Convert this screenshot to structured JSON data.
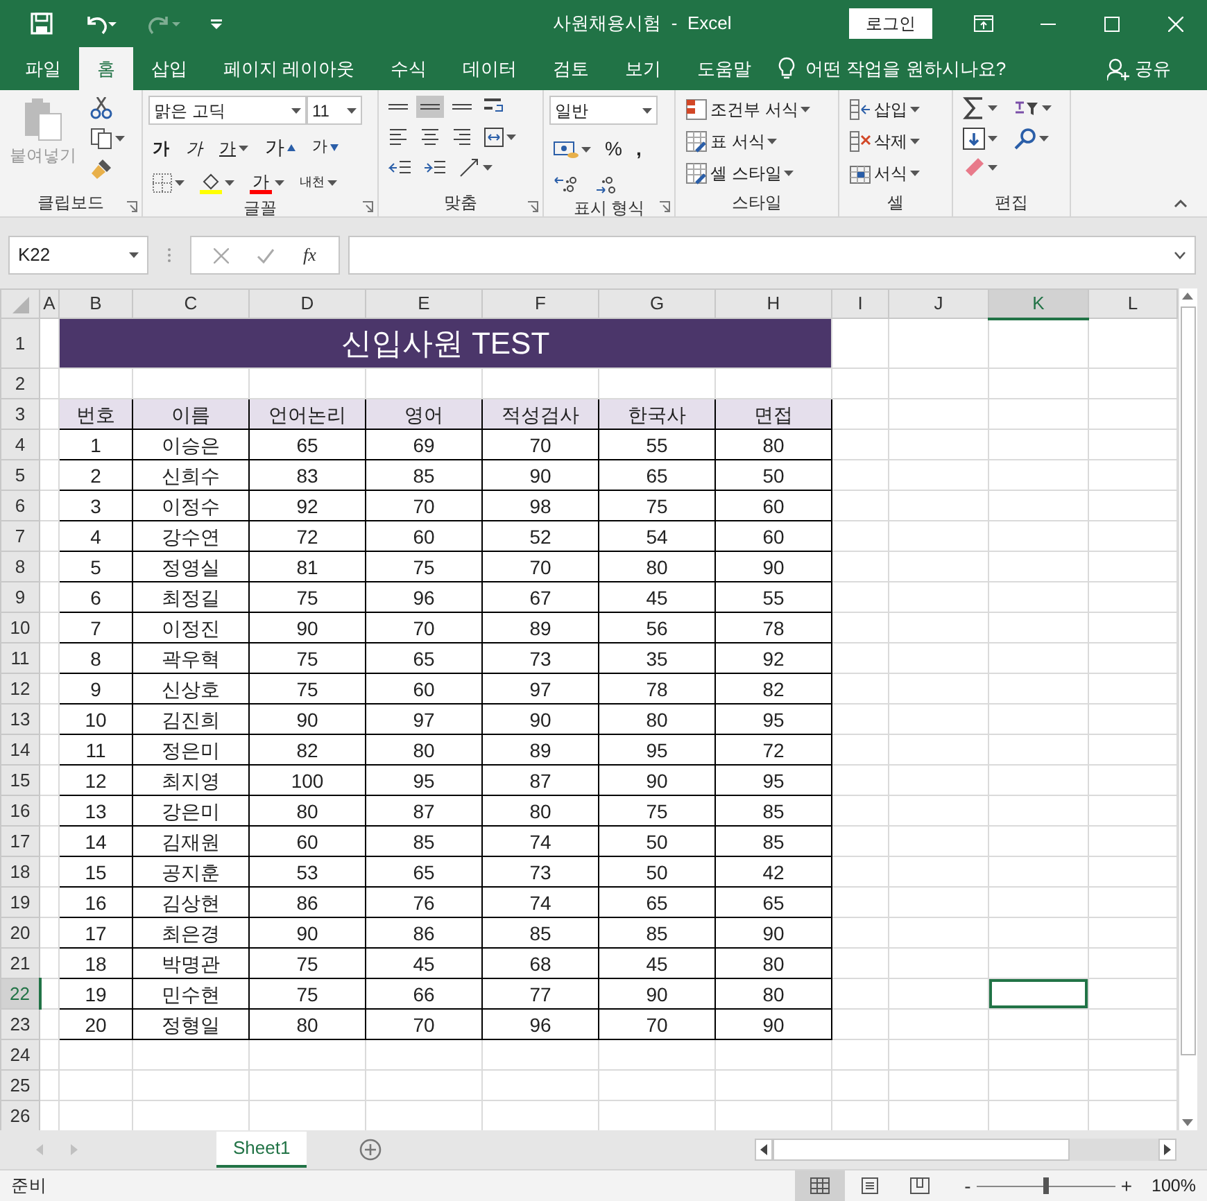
{
  "window": {
    "title": "사원채용시험  -  Excel",
    "login": "로그인"
  },
  "tabs": [
    {
      "label": "파일",
      "selected": false
    },
    {
      "label": "홈",
      "selected": true
    },
    {
      "label": "삽입",
      "selected": false
    },
    {
      "label": "페이지 레이아웃",
      "selected": false
    },
    {
      "label": "수식",
      "selected": false
    },
    {
      "label": "데이터",
      "selected": false
    },
    {
      "label": "검토",
      "selected": false
    },
    {
      "label": "보기",
      "selected": false
    },
    {
      "label": "도움말",
      "selected": false
    }
  ],
  "tell_me": {
    "placeholder": "어떤 작업을 원하시나요?"
  },
  "share": "공유",
  "ribbon": {
    "clipboard": {
      "label": "클립보드",
      "paste": {
        "label": "붙여넣기",
        "disabled": true
      }
    },
    "font": {
      "label": "글꼴",
      "font_name": "맑은 고딕",
      "font_size": "11",
      "bold": "가",
      "italic": "가",
      "underline": "가",
      "grow": "가",
      "shrink": "가",
      "font_color": "가",
      "phonetic": "내천"
    },
    "alignment": {
      "label": "맞춤",
      "middle_selected": true
    },
    "number": {
      "label": "표시 형식",
      "format": "일반",
      "percent": "%",
      "comma": ","
    },
    "styles": {
      "label": "스타일",
      "items": [
        "조건부 서식",
        "표 서식",
        "셀 스타일"
      ]
    },
    "cells": {
      "label": "셀",
      "items": [
        "삽입",
        "삭제",
        "서식"
      ]
    },
    "editing": {
      "label": "편집"
    }
  },
  "formula_bar": {
    "name_box": "K22",
    "fx": "fx"
  },
  "sheet": {
    "columns": [
      {
        "label": "A",
        "selected": false
      },
      {
        "label": "B",
        "selected": false
      },
      {
        "label": "C",
        "selected": false
      },
      {
        "label": "D",
        "selected": false
      },
      {
        "label": "E",
        "selected": false
      },
      {
        "label": "F",
        "selected": false
      },
      {
        "label": "G",
        "selected": false
      },
      {
        "label": "H",
        "selected": false
      },
      {
        "label": "I",
        "selected": false
      },
      {
        "label": "J",
        "selected": false
      },
      {
        "label": "K",
        "selected": true
      },
      {
        "label": "L",
        "selected": false
      }
    ],
    "rows": [
      {
        "label": "1",
        "selected": false
      },
      {
        "label": "2",
        "selected": false
      },
      {
        "label": "3",
        "selected": false
      },
      {
        "label": "4",
        "selected": false
      },
      {
        "label": "5",
        "selected": false
      },
      {
        "label": "6",
        "selected": false
      },
      {
        "label": "7",
        "selected": false
      },
      {
        "label": "8",
        "selected": false
      },
      {
        "label": "9",
        "selected": false
      },
      {
        "label": "10",
        "selected": false
      },
      {
        "label": "11",
        "selected": false
      },
      {
        "label": "12",
        "selected": false
      },
      {
        "label": "13",
        "selected": false
      },
      {
        "label": "14",
        "selected": false
      },
      {
        "label": "15",
        "selected": false
      },
      {
        "label": "16",
        "selected": false
      },
      {
        "label": "17",
        "selected": false
      },
      {
        "label": "18",
        "selected": false
      },
      {
        "label": "19",
        "selected": false
      },
      {
        "label": "20",
        "selected": false
      },
      {
        "label": "21",
        "selected": false
      },
      {
        "label": "22",
        "selected": true
      },
      {
        "label": "23",
        "selected": false
      },
      {
        "label": "24",
        "selected": false
      },
      {
        "label": "25",
        "selected": false
      },
      {
        "label": "26",
        "selected": false
      }
    ],
    "title": "신입사원 TEST",
    "table": {
      "columns": [
        "번호",
        "이름",
        "언어논리",
        "영어",
        "적성검사",
        "한국사",
        "면접"
      ],
      "rows": [
        [
          "1",
          "이승은",
          "65",
          "69",
          "70",
          "55",
          "80"
        ],
        [
          "2",
          "신희수",
          "83",
          "85",
          "90",
          "65",
          "50"
        ],
        [
          "3",
          "이정수",
          "92",
          "70",
          "98",
          "75",
          "60"
        ],
        [
          "4",
          "강수연",
          "72",
          "60",
          "52",
          "54",
          "60"
        ],
        [
          "5",
          "정영실",
          "81",
          "75",
          "70",
          "80",
          "90"
        ],
        [
          "6",
          "최정길",
          "75",
          "96",
          "67",
          "45",
          "55"
        ],
        [
          "7",
          "이정진",
          "90",
          "70",
          "89",
          "56",
          "78"
        ],
        [
          "8",
          "곽우혁",
          "75",
          "65",
          "73",
          "35",
          "92"
        ],
        [
          "9",
          "신상호",
          "75",
          "60",
          "97",
          "78",
          "82"
        ],
        [
          "10",
          "김진희",
          "90",
          "97",
          "90",
          "80",
          "95"
        ],
        [
          "11",
          "정은미",
          "82",
          "80",
          "89",
          "95",
          "72"
        ],
        [
          "12",
          "최지영",
          "100",
          "95",
          "87",
          "90",
          "95"
        ],
        [
          "13",
          "강은미",
          "80",
          "87",
          "80",
          "75",
          "85"
        ],
        [
          "14",
          "김재원",
          "60",
          "85",
          "74",
          "50",
          "85"
        ],
        [
          "15",
          "공지훈",
          "53",
          "65",
          "73",
          "50",
          "42"
        ],
        [
          "16",
          "김상현",
          "86",
          "76",
          "74",
          "65",
          "65"
        ],
        [
          "17",
          "최은경",
          "90",
          "86",
          "85",
          "85",
          "90"
        ],
        [
          "18",
          "박명관",
          "75",
          "45",
          "68",
          "45",
          "80"
        ],
        [
          "19",
          "민수현",
          "75",
          "66",
          "77",
          "90",
          "80"
        ],
        [
          "20",
          "정형일",
          "80",
          "70",
          "96",
          "70",
          "90"
        ]
      ]
    }
  },
  "sheet_tabs": [
    {
      "label": "Sheet1",
      "selected": true
    }
  ],
  "status_bar": {
    "text": "준비",
    "views": [
      {
        "selected": true
      },
      {
        "selected": false
      },
      {
        "selected": false
      }
    ],
    "zoom": {
      "minus": "-",
      "plus": "+",
      "level": 0.5,
      "reading": "100%"
    }
  }
}
